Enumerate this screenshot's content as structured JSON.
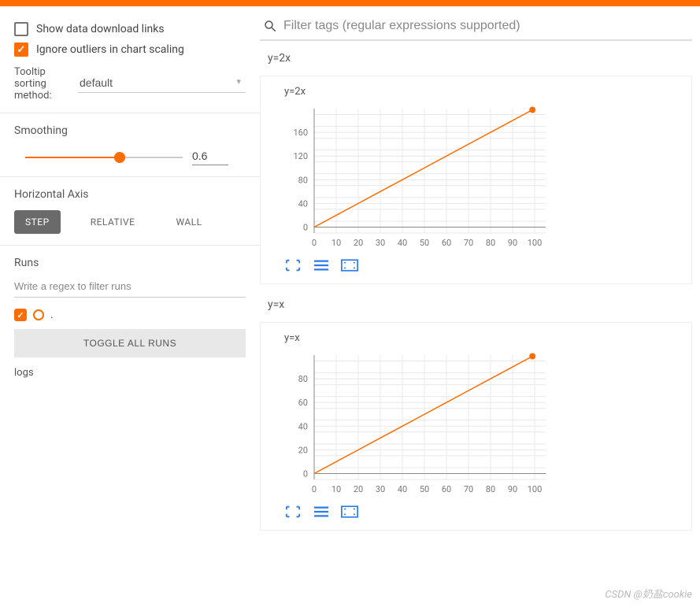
{
  "sidebar": {
    "show_download_links": {
      "label": "Show data download links",
      "checked": false
    },
    "ignore_outliers": {
      "label": "Ignore outliers in chart scaling",
      "checked": true
    },
    "tooltip_sorting": {
      "label": "Tooltip sorting method:",
      "value": "default"
    },
    "smoothing": {
      "label": "Smoothing",
      "value": "0.6",
      "percent": 60
    },
    "horizontal_axis": {
      "label": "Horizontal Axis",
      "options": [
        "STEP",
        "RELATIVE",
        "WALL"
      ],
      "active": "STEP"
    },
    "runs": {
      "label": "Runs",
      "placeholder": "Write a regex to filter runs",
      "run_name": ".",
      "toggle_label": "TOGGLE ALL RUNS",
      "logs": "logs"
    }
  },
  "filter": {
    "placeholder": "Filter tags (regular expressions supported)"
  },
  "charts": [
    {
      "header": "y=2x",
      "title": "y=2x"
    },
    {
      "header": "y=x",
      "title": "y=x"
    }
  ],
  "chart_data": [
    {
      "type": "line",
      "title": "y=2x",
      "xlabel": "",
      "ylabel": "",
      "x": [
        0,
        10,
        20,
        30,
        40,
        50,
        60,
        70,
        80,
        90,
        99
      ],
      "values": [
        0,
        20,
        40,
        60,
        80,
        100,
        120,
        140,
        160,
        180,
        198
      ],
      "xlim": [
        0,
        105
      ],
      "ylim": [
        -10,
        200
      ],
      "xticks": [
        0,
        10,
        20,
        30,
        40,
        50,
        60,
        70,
        80,
        90,
        100
      ],
      "yticks": [
        0,
        40,
        80,
        120,
        160
      ],
      "series": [
        {
          "name": ".",
          "color": "#ff6d00"
        }
      ]
    },
    {
      "type": "line",
      "title": "y=x",
      "xlabel": "",
      "ylabel": "",
      "x": [
        0,
        10,
        20,
        30,
        40,
        50,
        60,
        70,
        80,
        90,
        99
      ],
      "values": [
        0,
        10,
        20,
        30,
        40,
        50,
        60,
        70,
        80,
        90,
        99
      ],
      "xlim": [
        0,
        105
      ],
      "ylim": [
        -5,
        100
      ],
      "xticks": [
        0,
        10,
        20,
        30,
        40,
        50,
        60,
        70,
        80,
        90,
        100
      ],
      "yticks": [
        0,
        20,
        40,
        60,
        80
      ],
      "series": [
        {
          "name": ".",
          "color": "#ff6d00"
        }
      ]
    }
  ],
  "watermark": "CSDN @奶盐cookie"
}
